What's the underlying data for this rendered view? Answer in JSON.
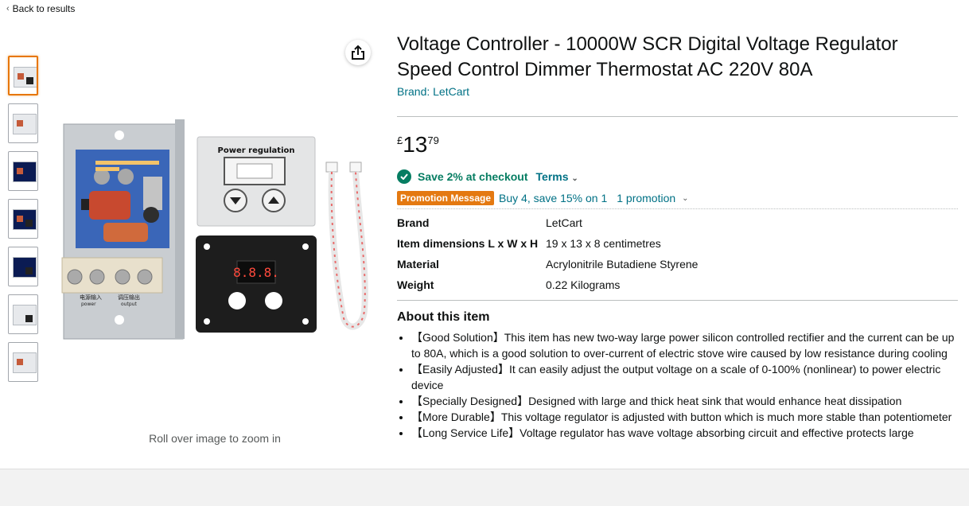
{
  "nav": {
    "back_label": "Back to results"
  },
  "gallery": {
    "thumbnail_count": 7,
    "zoom_hint": "Roll over image to zoom in",
    "product_image": {
      "panel_label": "Power regulation",
      "led_display": "8.8.8.",
      "board_label_left": "电源输入",
      "board_label_right": "调压输出",
      "board_sub_left": "power",
      "board_sub_right": "output"
    }
  },
  "product": {
    "title": "Voltage Controller - 10000W SCR Digital Voltage Regulator Speed Control Dimmer Thermostat AC 220V 80A",
    "brand_link": "Brand: LetCart"
  },
  "price": {
    "symbol": "£",
    "whole": "13",
    "fraction": "79"
  },
  "coupon": {
    "text": "Save 2% at checkout",
    "terms_label": "Terms"
  },
  "promotion": {
    "badge": "Promotion Message",
    "offer": "Buy 4, save 15% on 1",
    "link": "1 promotion"
  },
  "specs": [
    {
      "label": "Brand",
      "value": "LetCart"
    },
    {
      "label": "Item dimensions L x W x H",
      "value": "19 x 13 x 8 centimetres"
    },
    {
      "label": "Material",
      "value": "Acrylonitrile Butadiene Styrene"
    },
    {
      "label": "Weight",
      "value": "0.22 Kilograms"
    }
  ],
  "about": {
    "heading": "About this item",
    "bullets": [
      "【Good Solution】This item has new two-way large power silicon controlled rectifier and the current can be up to 80A, which is a good solution to over-current of electric stove wire caused by low resistance during cooling",
      "【Easily Adjusted】It can easily adjust the output voltage on a scale of 0-100% (nonlinear) to power electric device",
      "【Specially Designed】Designed with large and thick heat sink that would enhance heat dissipation",
      "【More Durable】This voltage regulator is adjusted with button which is much more stable than potentiometer",
      "【Long Service Life】Voltage regulator has wave voltage absorbing circuit and effective protects large"
    ]
  },
  "colors": {
    "link": "#007185",
    "promo_badge": "#e47911",
    "coupon_green": "#067d62",
    "thumb_selected": "#e77600"
  }
}
